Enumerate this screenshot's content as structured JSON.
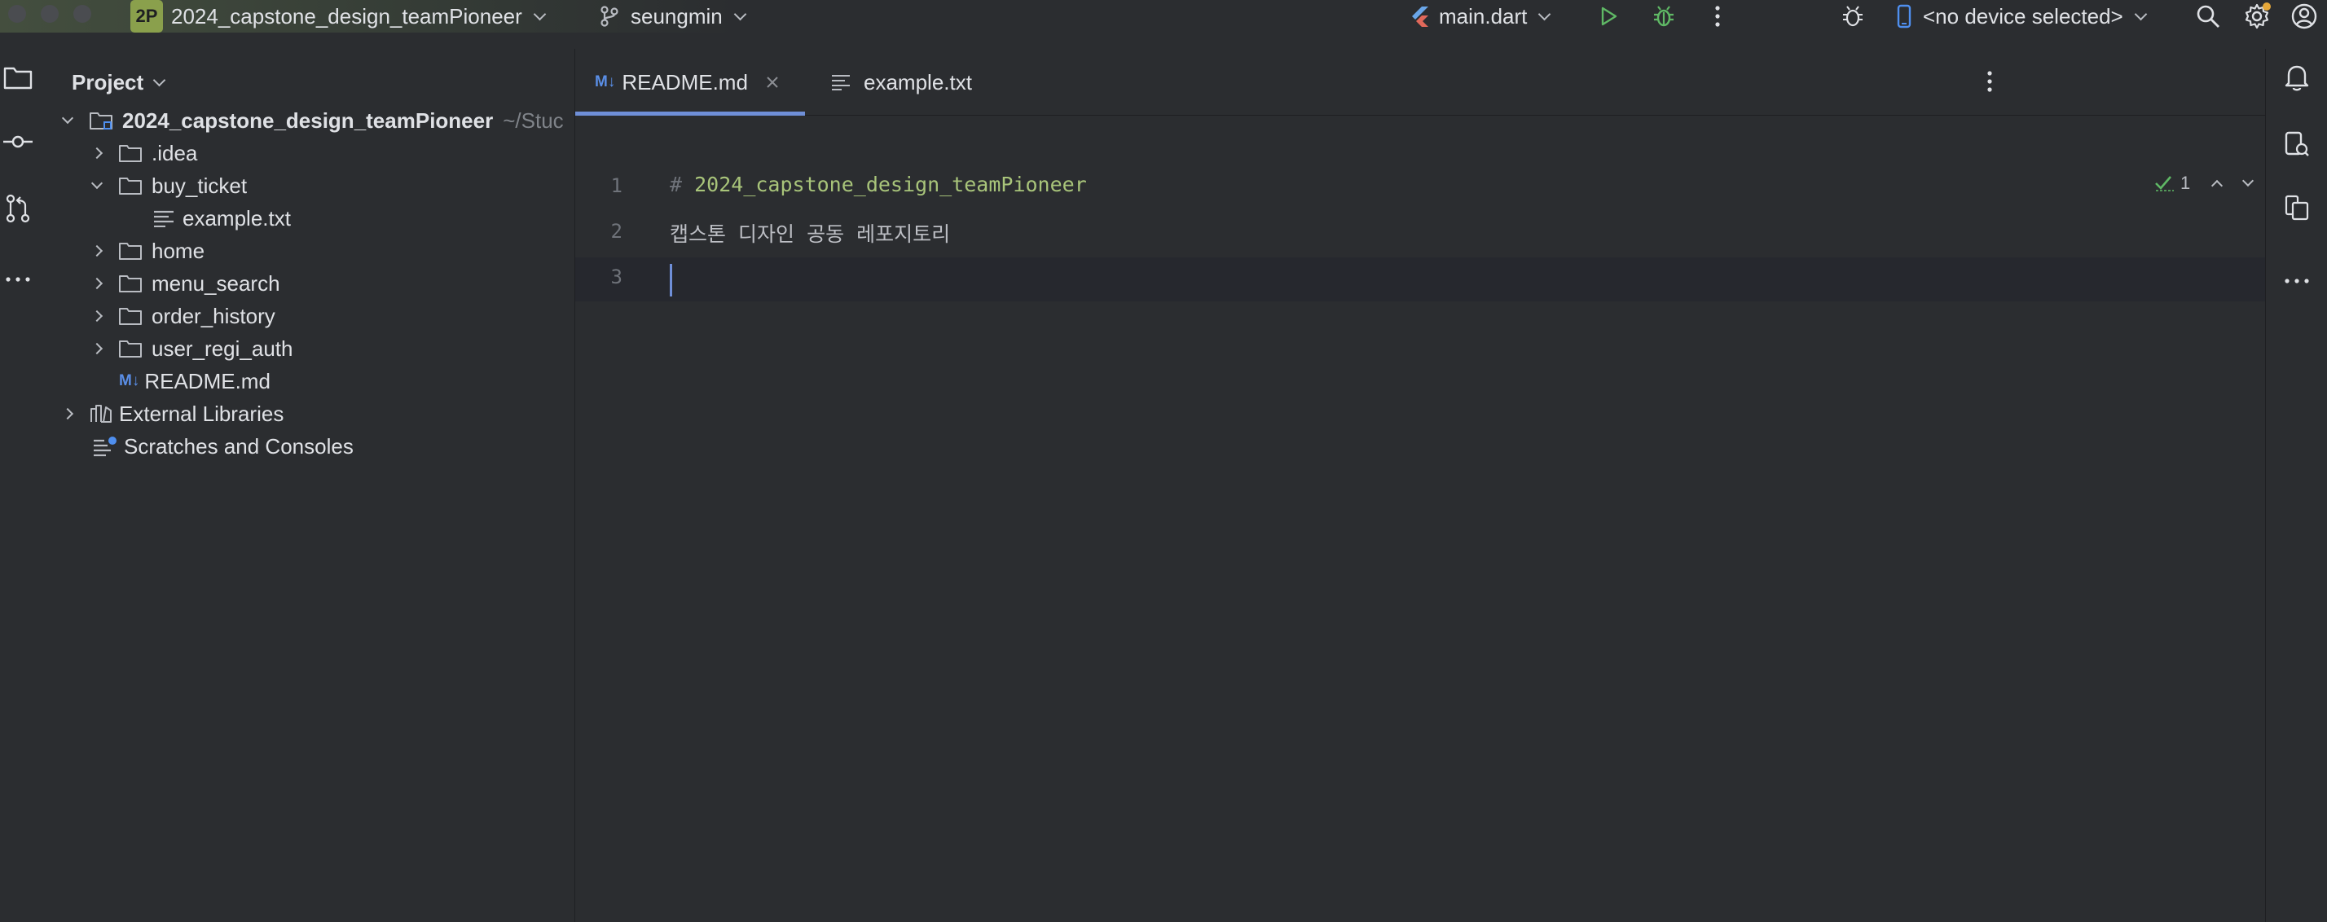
{
  "titlebar": {
    "project_badge": "2P",
    "project_name": "2024_capstone_design_teamPioneer",
    "branch": "seungmin",
    "run_config": "main.dart",
    "device": "<no device selected>"
  },
  "project_panel": {
    "title": "Project",
    "root": {
      "name": "2024_capstone_design_teamPioneer",
      "path_hint": "~/Stuc"
    },
    "items": [
      {
        "name": ".idea",
        "type": "folder",
        "expanded": false,
        "depth": 1
      },
      {
        "name": "buy_ticket",
        "type": "folder",
        "expanded": true,
        "depth": 1
      },
      {
        "name": "example.txt",
        "type": "text-file",
        "depth": 2
      },
      {
        "name": "home",
        "type": "folder",
        "expanded": false,
        "depth": 1
      },
      {
        "name": "menu_search",
        "type": "folder",
        "expanded": false,
        "depth": 1
      },
      {
        "name": "order_history",
        "type": "folder",
        "expanded": false,
        "depth": 1
      },
      {
        "name": "user_regi_auth",
        "type": "folder",
        "expanded": false,
        "depth": 1
      },
      {
        "name": "README.md",
        "type": "markdown-file",
        "depth": 1
      }
    ],
    "external_libraries": "External Libraries",
    "scratches": "Scratches and Consoles"
  },
  "editor": {
    "tabs": [
      {
        "label": "README.md",
        "active": true,
        "icon": "markdown-icon"
      },
      {
        "label": "example.txt",
        "active": false,
        "icon": "text-file-icon"
      }
    ],
    "inspection_count": "1",
    "lines": [
      {
        "number": "1",
        "hash": "# ",
        "text": "2024_capstone_design_teamPioneer"
      },
      {
        "number": "2",
        "hash": "",
        "text": "캡스톤 디자인 공동 레포지토리"
      },
      {
        "number": "3",
        "hash": "",
        "text": ""
      }
    ]
  },
  "markdown_badge": "M↓",
  "colors": {
    "accent": "#6f8fd8",
    "badge": "#8aa04c",
    "run_green": "#5fb865",
    "md_title": "#a8c47a"
  }
}
